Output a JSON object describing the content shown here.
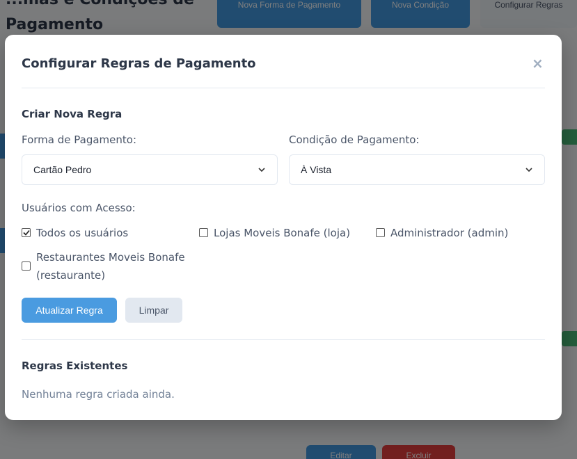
{
  "background": {
    "title": "...mas e Condições de Pagamento",
    "buttons": [
      "Nova Forma de Pagamento",
      "Nova Condição",
      "Configurar Regras"
    ],
    "bottom_buttons": [
      "Editar",
      "Excluir"
    ]
  },
  "modal": {
    "title": "Configurar Regras de Pagamento",
    "close_label": "×",
    "create_section_title": "Criar Nova Regra",
    "payment_method_label": "Forma de Pagamento:",
    "payment_method_value": "Cartão Pedro",
    "payment_condition_label": "Condição de Pagamento:",
    "payment_condition_value": "À Vista",
    "users_label": "Usuários com Acesso:",
    "users": [
      {
        "label": "Todos os usuários",
        "checked": true
      },
      {
        "label": "Lojas Moveis Bonafe (loja)",
        "checked": false
      },
      {
        "label": "Administrador (admin)",
        "checked": false
      },
      {
        "label": "Restaurantes Moveis Bonafe (restaurante)",
        "checked": false
      }
    ],
    "update_button": "Atualizar Regra",
    "clear_button": "Limpar",
    "existing_section_title": "Regras Existentes",
    "empty_message": "Nenhuma regra criada ainda."
  },
  "colors": {
    "primary": "#4a9be0",
    "secondary": "#e2e8f0",
    "overlay": "rgba(0,0,0,0.5)"
  }
}
